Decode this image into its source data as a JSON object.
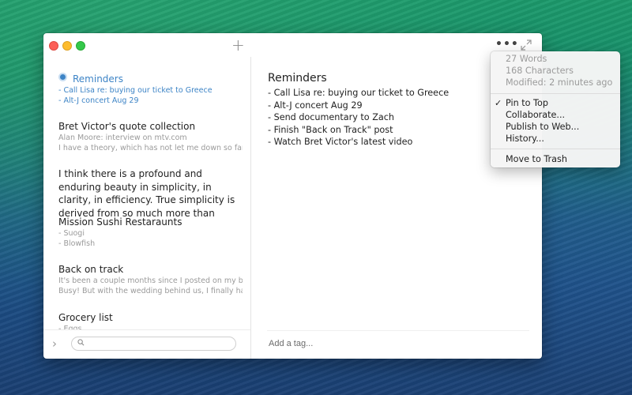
{
  "window": {
    "add_label": "+",
    "more_label": "•••"
  },
  "sidebar": {
    "notes": [
      {
        "title": "Reminders",
        "pinned": true,
        "body": [
          "- Call Lisa re: buying our ticket to Greece",
          "- Alt-J concert Aug 29"
        ]
      },
      {
        "title": "Bret Victor's quote collection",
        "pinned": false,
        "body": [
          "Alan Moore: interview on mtv.com",
          "I have a theory, which has not let me down so far, that"
        ]
      },
      {
        "title": "I think there is a profound and enduring beauty in simplicity, in clarity, in efficiency. True simplicity is derived from so much more than",
        "pinned": false,
        "body": []
      },
      {
        "title": "Mission Sushi Restaraunts",
        "pinned": false,
        "body": [
          "- Suogi",
          "- Blowfish"
        ]
      },
      {
        "title": "Back on track",
        "pinned": false,
        "body": [
          "It's been a couple months since I posted on my blog.",
          "Busy! But with the wedding behind us, I finally have"
        ]
      },
      {
        "title": "Grocery list",
        "pinned": false,
        "body": [
          "- Eggs"
        ]
      }
    ],
    "search": {
      "value": "",
      "placeholder": ""
    },
    "collapse_label": "›"
  },
  "editor": {
    "title": "Reminders",
    "lines": [
      "- Call Lisa re: buying our ticket to Greece",
      "- Alt-J concert Aug 29",
      "- Send documentary to Zach",
      "- Finish \"Back on Track\" post",
      "- Watch Bret Victor's latest video"
    ],
    "tag_placeholder": "Add a tag..."
  },
  "menu": {
    "info": [
      "27 Words",
      "168 Characters",
      "Modified: 2 minutes ago"
    ],
    "items": [
      {
        "label": "Pin to Top",
        "checked": true,
        "check_glyph": "✓"
      },
      {
        "label": "Collaborate...",
        "checked": false
      },
      {
        "label": "Publish to Web...",
        "checked": false
      },
      {
        "label": "History...",
        "checked": false
      }
    ],
    "trash_label": "Move to Trash"
  },
  "colors": {
    "accent": "#3d84c6",
    "close": "#fc5f57",
    "minimize": "#fdbc2e",
    "maximize": "#34c84a"
  }
}
